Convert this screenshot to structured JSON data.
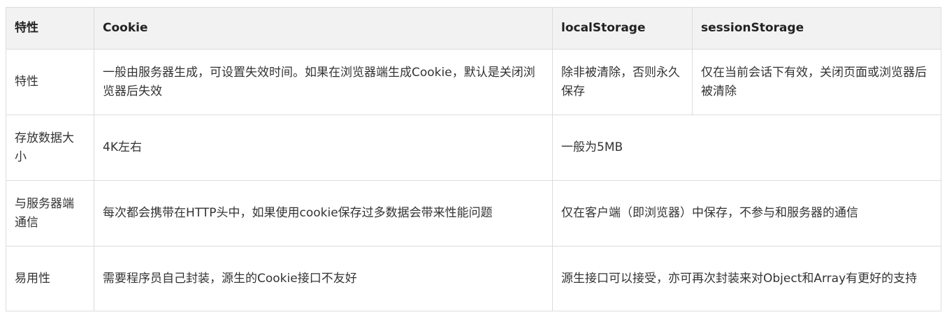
{
  "table": {
    "headers": [
      "特性",
      "Cookie",
      "localStorage",
      "sessionStorage"
    ],
    "rows": [
      {
        "label": "特性",
        "cookie": "一般由服务器生成，可设置失效时间。如果在浏览器端生成Cookie，默认是关闭浏览器后失效",
        "local": "除非被清除，否则永久保存",
        "session": "仅在当前会话下有效，关闭页面或浏览器后被清除"
      },
      {
        "label": "存放数据大小",
        "cookie": "4K左右",
        "storage": "一般为5MB"
      },
      {
        "label": "与服务器端通信",
        "cookie": "每次都会携带在HTTP头中，如果使用cookie保存过多数据会带来性能问题",
        "storage": "仅在客户端（即浏览器）中保存，不参与和服务器的通信"
      },
      {
        "label": "易用性",
        "cookie": "需要程序员自己封装，源生的Cookie接口不友好",
        "storage": "源生接口可以接受，亦可再次封装来对Object和Array有更好的支持"
      }
    ]
  }
}
